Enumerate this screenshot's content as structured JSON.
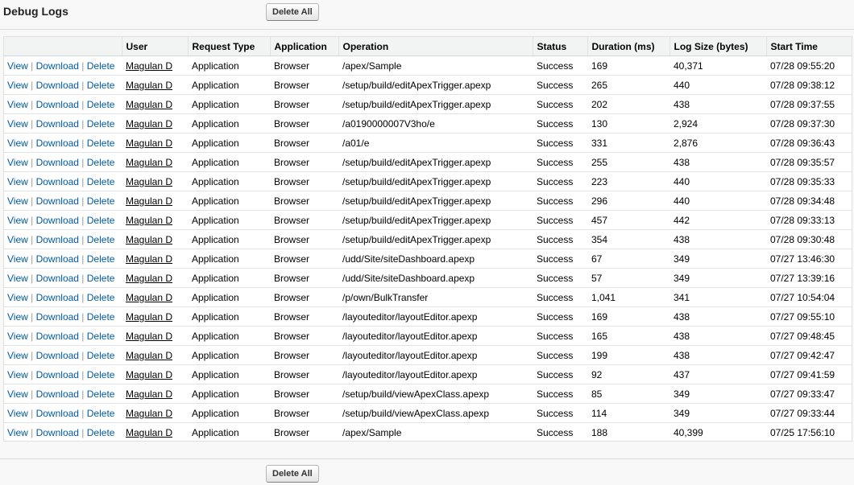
{
  "page": {
    "title": "Debug Logs",
    "delete_all_label": "Delete All"
  },
  "actions": {
    "view": "View",
    "download": "Download",
    "delete": "Delete",
    "separator": "|"
  },
  "columns": [
    "",
    "User",
    "Request Type",
    "Application",
    "Operation",
    "Status",
    "Duration (ms)",
    "Log Size (bytes)",
    "Start Time"
  ],
  "rows": [
    {
      "user": "Magulan D",
      "request_type": "Application",
      "application": "Browser",
      "operation": "/apex/Sample",
      "status": "Success",
      "duration": "169",
      "size": "40,371",
      "start": "07/28 09:55:20"
    },
    {
      "user": "Magulan D",
      "request_type": "Application",
      "application": "Browser",
      "operation": "/setup/build/editApexTrigger.apexp",
      "status": "Success",
      "duration": "265",
      "size": "440",
      "start": "07/28 09:38:12"
    },
    {
      "user": "Magulan D",
      "request_type": "Application",
      "application": "Browser",
      "operation": "/setup/build/editApexTrigger.apexp",
      "status": "Success",
      "duration": "202",
      "size": "438",
      "start": "07/28 09:37:55"
    },
    {
      "user": "Magulan D",
      "request_type": "Application",
      "application": "Browser",
      "operation": "/a0190000007V3ho/e",
      "status": "Success",
      "duration": "130",
      "size": "2,924",
      "start": "07/28 09:37:30"
    },
    {
      "user": "Magulan D",
      "request_type": "Application",
      "application": "Browser",
      "operation": "/a01/e",
      "status": "Success",
      "duration": "331",
      "size": "2,876",
      "start": "07/28 09:36:43"
    },
    {
      "user": "Magulan D",
      "request_type": "Application",
      "application": "Browser",
      "operation": "/setup/build/editApexTrigger.apexp",
      "status": "Success",
      "duration": "255",
      "size": "438",
      "start": "07/28 09:35:57"
    },
    {
      "user": "Magulan D",
      "request_type": "Application",
      "application": "Browser",
      "operation": "/setup/build/editApexTrigger.apexp",
      "status": "Success",
      "duration": "223",
      "size": "440",
      "start": "07/28 09:35:33"
    },
    {
      "user": "Magulan D",
      "request_type": "Application",
      "application": "Browser",
      "operation": "/setup/build/editApexTrigger.apexp",
      "status": "Success",
      "duration": "296",
      "size": "440",
      "start": "07/28 09:34:48"
    },
    {
      "user": "Magulan D",
      "request_type": "Application",
      "application": "Browser",
      "operation": "/setup/build/editApexTrigger.apexp",
      "status": "Success",
      "duration": "457",
      "size": "442",
      "start": "07/28 09:33:13"
    },
    {
      "user": "Magulan D",
      "request_type": "Application",
      "application": "Browser",
      "operation": "/setup/build/editApexTrigger.apexp",
      "status": "Success",
      "duration": "354",
      "size": "438",
      "start": "07/28 09:30:48"
    },
    {
      "user": "Magulan D",
      "request_type": "Application",
      "application": "Browser",
      "operation": "/udd/Site/siteDashboard.apexp",
      "status": "Success",
      "duration": "67",
      "size": "349",
      "start": "07/27 13:46:30"
    },
    {
      "user": "Magulan D",
      "request_type": "Application",
      "application": "Browser",
      "operation": "/udd/Site/siteDashboard.apexp",
      "status": "Success",
      "duration": "57",
      "size": "349",
      "start": "07/27 13:39:16"
    },
    {
      "user": "Magulan D",
      "request_type": "Application",
      "application": "Browser",
      "operation": "/p/own/BulkTransfer",
      "status": "Success",
      "duration": "1,041",
      "size": "341",
      "start": "07/27 10:54:04"
    },
    {
      "user": "Magulan D",
      "request_type": "Application",
      "application": "Browser",
      "operation": "/layouteditor/layoutEditor.apexp",
      "status": "Success",
      "duration": "169",
      "size": "438",
      "start": "07/27 09:55:10"
    },
    {
      "user": "Magulan D",
      "request_type": "Application",
      "application": "Browser",
      "operation": "/layouteditor/layoutEditor.apexp",
      "status": "Success",
      "duration": "165",
      "size": "438",
      "start": "07/27 09:48:45"
    },
    {
      "user": "Magulan D",
      "request_type": "Application",
      "application": "Browser",
      "operation": "/layouteditor/layoutEditor.apexp",
      "status": "Success",
      "duration": "199",
      "size": "438",
      "start": "07/27 09:42:47"
    },
    {
      "user": "Magulan D",
      "request_type": "Application",
      "application": "Browser",
      "operation": "/layouteditor/layoutEditor.apexp",
      "status": "Success",
      "duration": "92",
      "size": "437",
      "start": "07/27 09:41:59"
    },
    {
      "user": "Magulan D",
      "request_type": "Application",
      "application": "Browser",
      "operation": "/setup/build/viewApexClass.apexp",
      "status": "Success",
      "duration": "85",
      "size": "349",
      "start": "07/27 09:33:47"
    },
    {
      "user": "Magulan D",
      "request_type": "Application",
      "application": "Browser",
      "operation": "/setup/build/viewApexClass.apexp",
      "status": "Success",
      "duration": "114",
      "size": "349",
      "start": "07/27 09:33:44"
    },
    {
      "user": "Magulan D",
      "request_type": "Application",
      "application": "Browser",
      "operation": "/apex/Sample",
      "status": "Success",
      "duration": "188",
      "size": "40,399",
      "start": "07/25 17:56:10"
    }
  ]
}
